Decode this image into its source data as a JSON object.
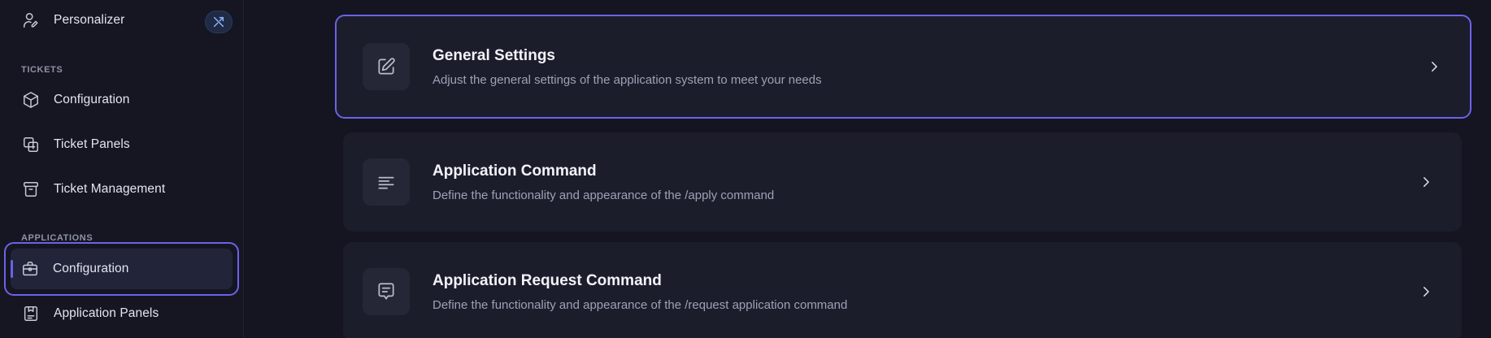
{
  "sidebar": {
    "top_item": {
      "label": "Personalizer",
      "icon": "user-edit-icon",
      "badge_icon": "tools-icon"
    },
    "sections": [
      {
        "title": "TICKETS",
        "items": [
          {
            "label": "Configuration",
            "icon": "cube-icon"
          },
          {
            "label": "Ticket Panels",
            "icon": "copy-plus-icon"
          },
          {
            "label": "Ticket Management",
            "icon": "archive-icon"
          }
        ]
      },
      {
        "title": "APPLICATIONS",
        "items": [
          {
            "label": "Configuration",
            "icon": "briefcase-icon",
            "active": true
          },
          {
            "label": "Application Panels",
            "icon": "clipboard-icon"
          }
        ]
      }
    ]
  },
  "main": {
    "cards": [
      {
        "title": "General Settings",
        "description": "Adjust the general settings of the application system to meet your needs",
        "icon": "edit-icon",
        "selected": true
      },
      {
        "title": "Application Command",
        "description": "Define the functionality and appearance of the /apply command",
        "icon": "align-left-icon"
      },
      {
        "title": "Application Request Command",
        "description": "Define the functionality and appearance of the /request application command",
        "icon": "message-square-icon"
      }
    ]
  },
  "colors": {
    "background": "#141521",
    "card": "#1c1d2b",
    "accent": "#6b63e8"
  }
}
